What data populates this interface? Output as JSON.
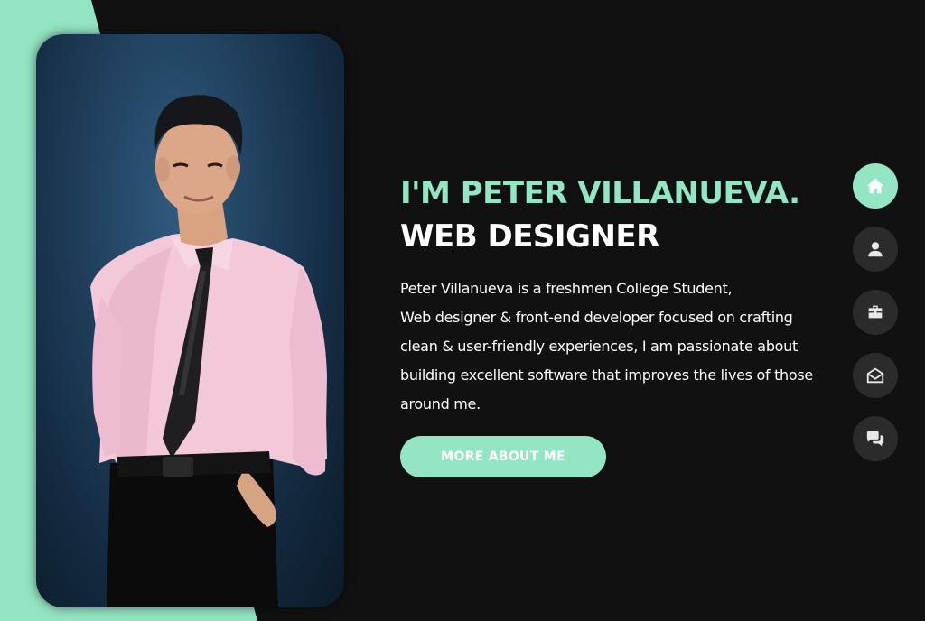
{
  "hero": {
    "greeting": "I'M PETER VILLANUEVA.",
    "role": "WEB DESIGNER",
    "description_lines": [
      "Peter Villanueva is a freshmen College Student,",
      "Web designer & front-end developer focused on crafting",
      "clean & user-friendly experiences, I am passionate about",
      "building excellent software that improves the lives of those",
      "around me."
    ],
    "cta_label": "MORE ABOUT ME"
  },
  "nav": {
    "items": [
      {
        "icon": "home-icon",
        "active": true
      },
      {
        "icon": "user-icon",
        "active": false
      },
      {
        "icon": "briefcase-icon",
        "active": false
      },
      {
        "icon": "envelope-open-icon",
        "active": false
      },
      {
        "icon": "comments-icon",
        "active": false
      }
    ]
  },
  "colors": {
    "accent": "#94e5c4",
    "background": "#111111",
    "nav_button": "#2b2b2b",
    "text": "#ffffff"
  }
}
